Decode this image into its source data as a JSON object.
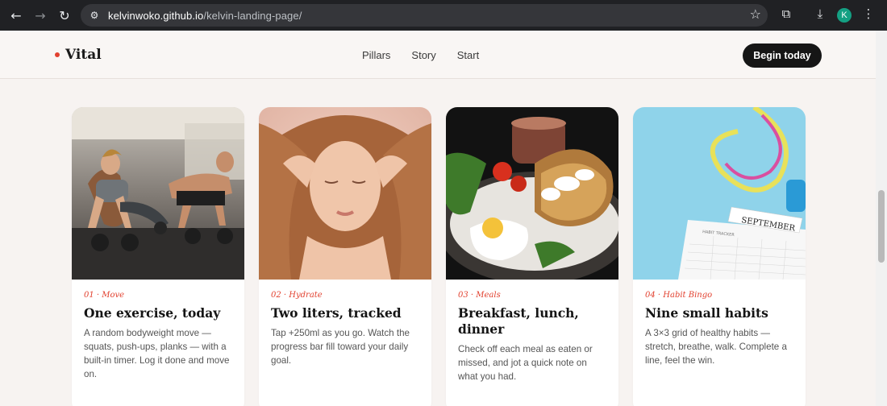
{
  "browser": {
    "url_host": "kelvinwoko.github.io",
    "url_path": "/kelvin-landing-page/",
    "profile_initial": "K"
  },
  "nav": {
    "logo": "Vital",
    "links": [
      "Pillars",
      "Story",
      "Start"
    ],
    "cta": "Begin today"
  },
  "cards": [
    {
      "tag": "01 · Move",
      "title": "One exercise, today",
      "desc": "A random bodyweight move — squats, push-ups, planks — with a built-in timer. Log it done and move on.",
      "image": "kettlebell-pushup-photo"
    },
    {
      "tag": "02 · Hydrate",
      "title": "Two liters, tracked",
      "desc": "Tap +250ml as you go. Watch the progress bar fill toward your daily goal.",
      "image": "resting-woman-photo"
    },
    {
      "tag": "03 · Meals",
      "title": "Breakfast, lunch, dinner",
      "desc": "Check off each meal as eaten or missed, and jot a quick note on what you had.",
      "image": "breakfast-plate-photo"
    },
    {
      "tag": "04 · Habit Bingo",
      "title": "Nine small habits",
      "desc": "A 3×3 grid of healthy habits — stretch, breathe, walk. Complete a line, feel the win.",
      "image": "habit-tracker-photo",
      "image_label": "SEPTEMBER",
      "image_sublabel": "HABIT TRACKER"
    }
  ],
  "colors": {
    "accent": "#e2412f",
    "background": "#f7f3f1",
    "cta": "#161616"
  }
}
